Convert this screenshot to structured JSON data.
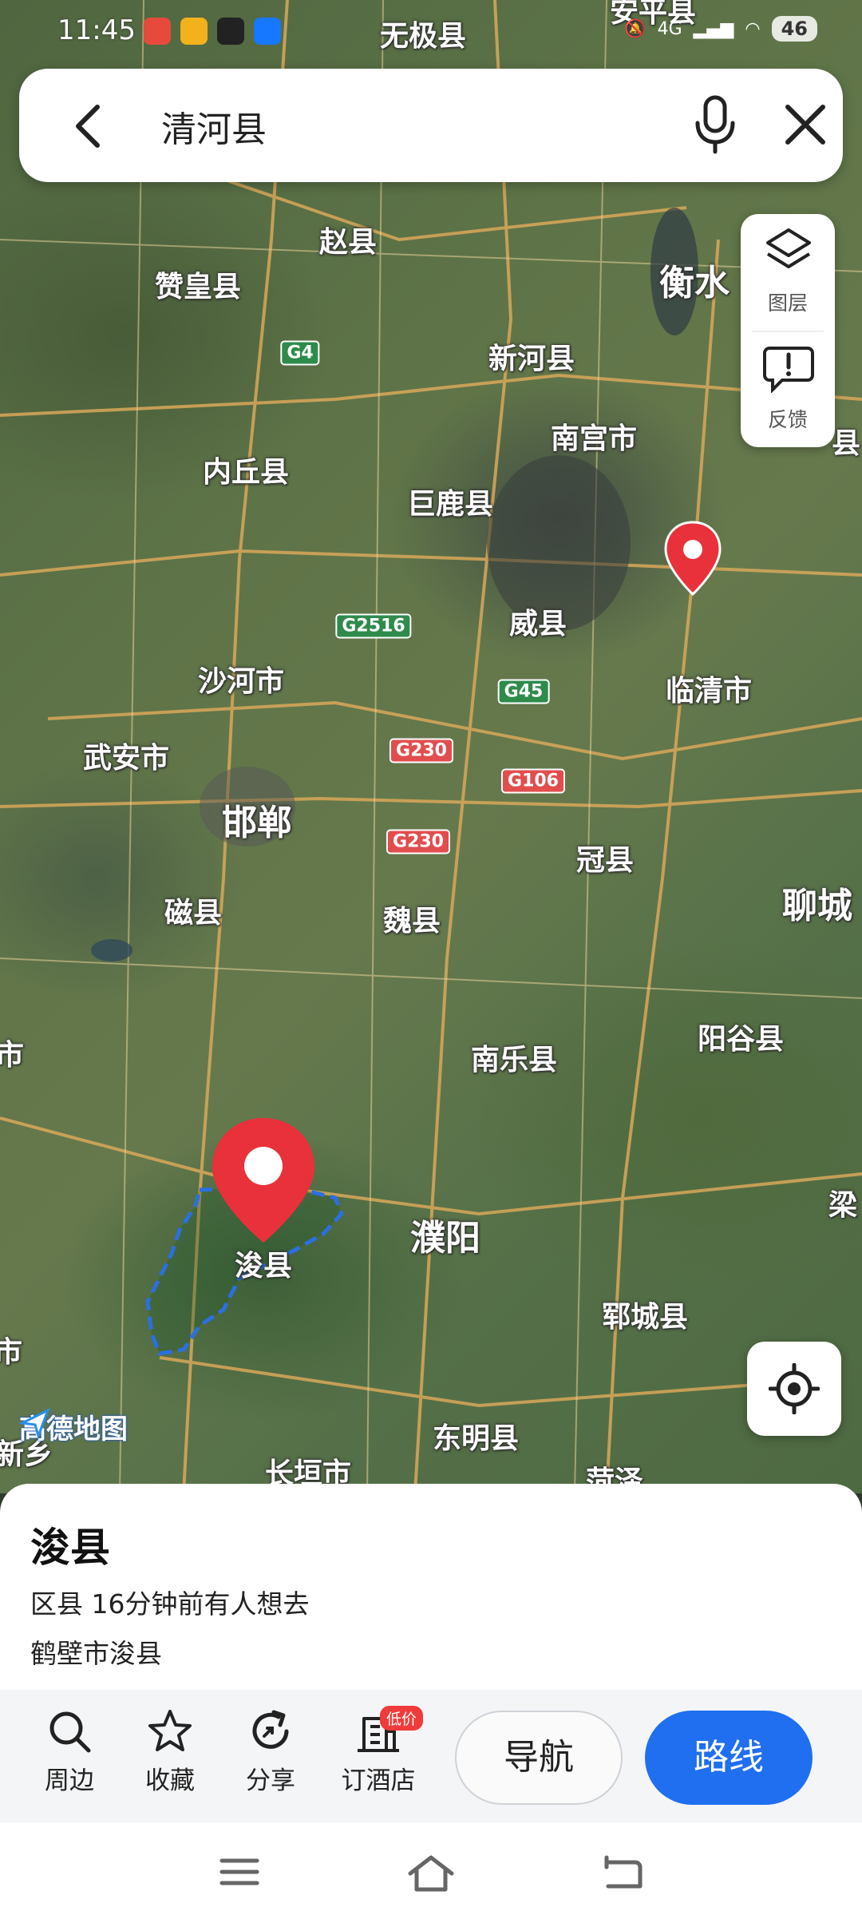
{
  "status_bar": {
    "time": "11:45",
    "signal_text": "4G",
    "battery": "46"
  },
  "search": {
    "query": "清河县"
  },
  "side_panel": {
    "layers_label": "图层",
    "feedback_label": "反馈"
  },
  "map": {
    "logo_text": "高德地图",
    "places": [
      {
        "name": "无极县",
        "big": false
      },
      {
        "name": "安平县",
        "big": false
      },
      {
        "name": "赵县",
        "big": false
      },
      {
        "name": "赞皇县",
        "big": false
      },
      {
        "name": "衡水",
        "big": true
      },
      {
        "name": "新河县",
        "big": false
      },
      {
        "name": "南宫市",
        "big": false
      },
      {
        "name": "内丘县",
        "big": false
      },
      {
        "name": "巨鹿县",
        "big": false
      },
      {
        "name": "威县",
        "big": false
      },
      {
        "name": "临清市",
        "big": false
      },
      {
        "name": "沙河市",
        "big": false
      },
      {
        "name": "武安市",
        "big": false
      },
      {
        "name": "邯郸",
        "big": true
      },
      {
        "name": "冠县",
        "big": false
      },
      {
        "name": "聊城",
        "big": true
      },
      {
        "name": "磁县",
        "big": false
      },
      {
        "name": "魏县",
        "big": false
      },
      {
        "name": "阳谷县",
        "big": false
      },
      {
        "name": "南乐县",
        "big": false
      },
      {
        "name": "濮阳",
        "big": true
      },
      {
        "name": "浚县",
        "big": false
      },
      {
        "name": "郓城县",
        "big": false
      },
      {
        "name": "东明县",
        "big": false
      },
      {
        "name": "长垣市",
        "big": false
      },
      {
        "name": "新乡",
        "big": false
      },
      {
        "name": "菏泽",
        "big": false
      },
      {
        "name": "梁",
        "big": false
      },
      {
        "name": "市",
        "big": false
      },
      {
        "name": "市",
        "big": false
      },
      {
        "name": "县",
        "big": false
      }
    ],
    "roads": [
      {
        "label": "G4",
        "type": "g"
      },
      {
        "label": "G2516",
        "type": "g"
      },
      {
        "label": "G45",
        "type": "g"
      },
      {
        "label": "G230",
        "type": "r"
      },
      {
        "label": "G106",
        "type": "r"
      },
      {
        "label": "G230",
        "type": "r"
      }
    ]
  },
  "sheet": {
    "title": "浚县",
    "meta": "区县  16分钟前有人想去",
    "address": "鹤壁市浚县"
  },
  "actions": {
    "nearby": "周边",
    "favorite": "收藏",
    "share": "分享",
    "hotel": "订酒店",
    "hotel_badge": "低价",
    "navigate": "导航",
    "route": "路线"
  },
  "colors": {
    "accent": "#1f6ff0",
    "pin": "#e8313a",
    "boundary": "#2b6fe0"
  }
}
